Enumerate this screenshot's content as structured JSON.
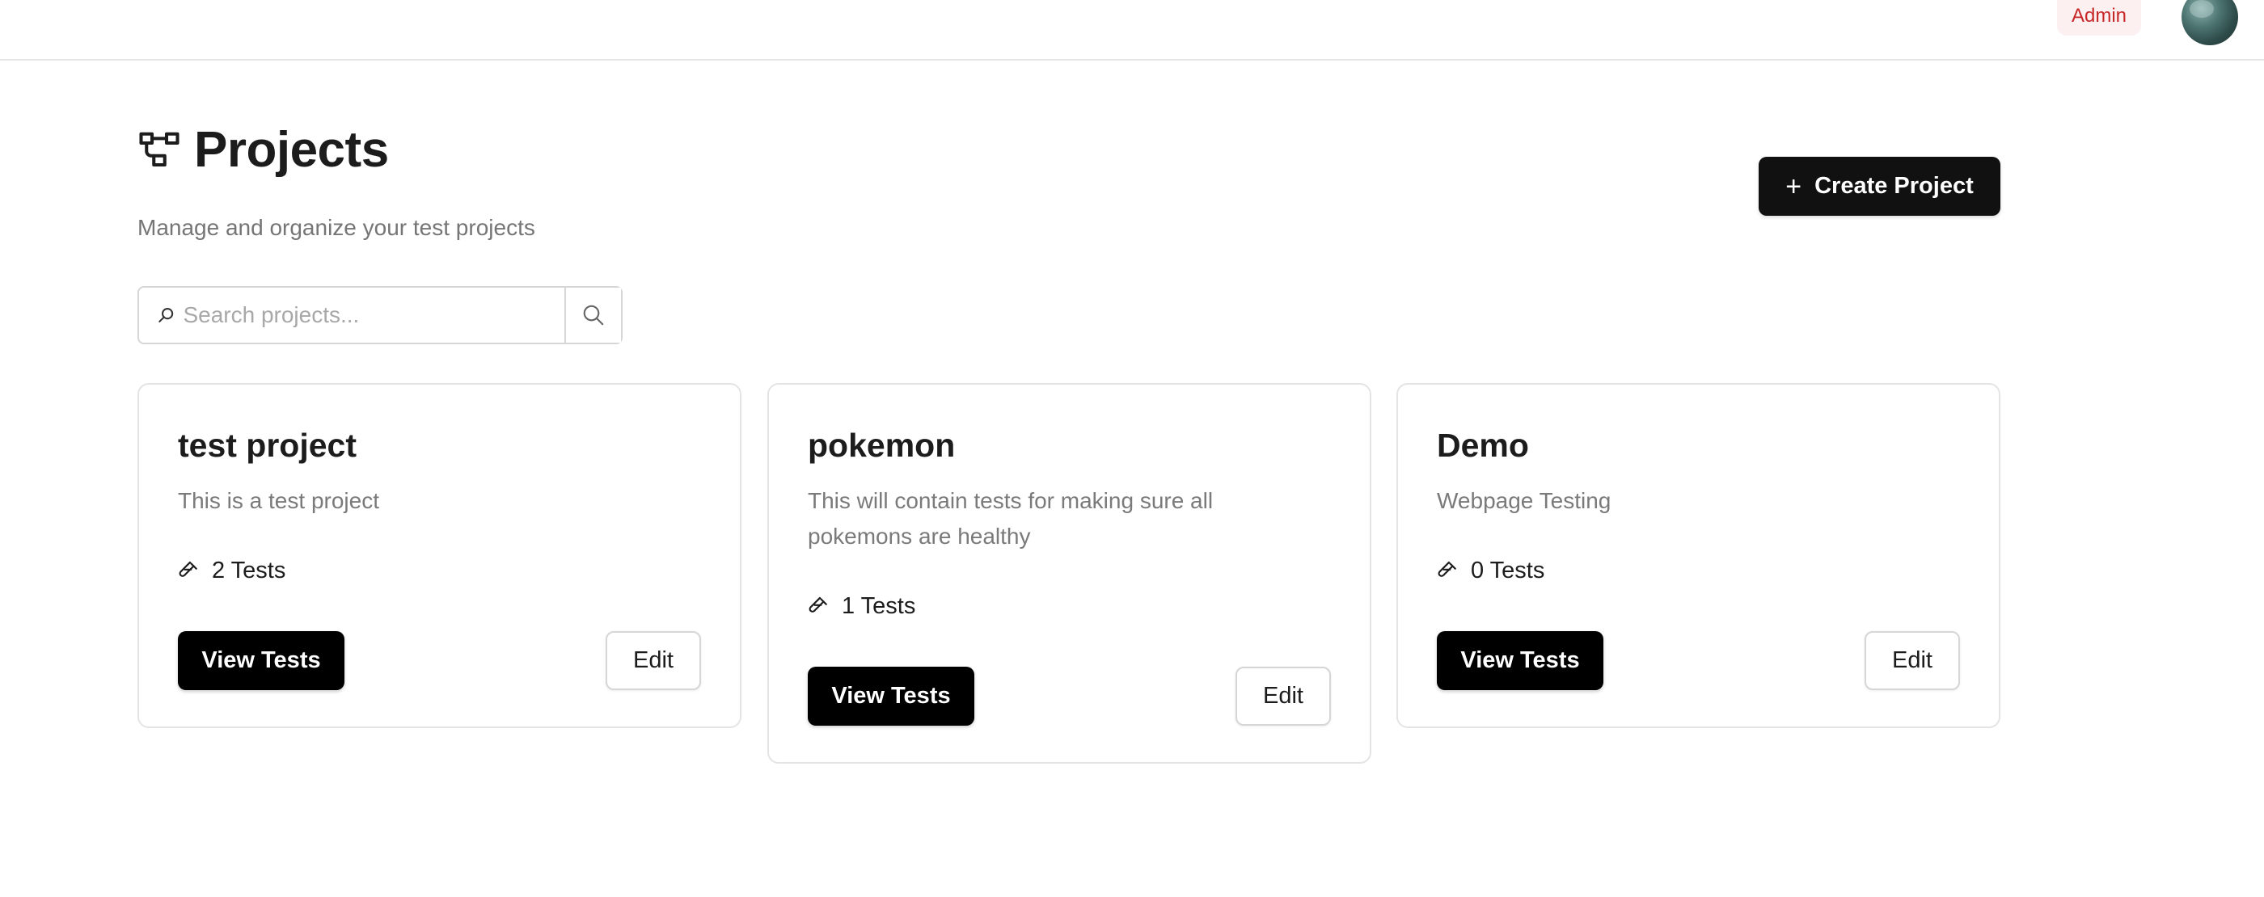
{
  "topbar": {
    "role_badge": "Admin"
  },
  "header": {
    "title": "Projects",
    "subtitle": "Manage and organize your test projects",
    "create_label": "Create Project"
  },
  "search": {
    "placeholder": "Search projects...",
    "value": ""
  },
  "projects": [
    {
      "name": "test project",
      "description": "This is a test project",
      "tests": "2 Tests",
      "view_label": "View Tests",
      "edit_label": "Edit"
    },
    {
      "name": "pokemon",
      "description": "This will contain tests for making sure all pokemons are healthy",
      "tests": "1 Tests",
      "view_label": "View Tests",
      "edit_label": "Edit"
    },
    {
      "name": "Demo",
      "description": "Webpage Testing",
      "tests": "0 Tests",
      "view_label": "View Tests",
      "edit_label": "Edit"
    }
  ],
  "icons": {
    "title": "workflow-icon",
    "create": "plus-icon",
    "search_field": "search-icon",
    "search_button": "search-icon",
    "tests": "test-tube-icon"
  },
  "colors": {
    "primary_button": "#111111",
    "admin_badge_text": "#c62828",
    "admin_badge_bg": "#fdf0f0",
    "muted_text": "#7a7a7a",
    "border": "#e4e4e4"
  }
}
